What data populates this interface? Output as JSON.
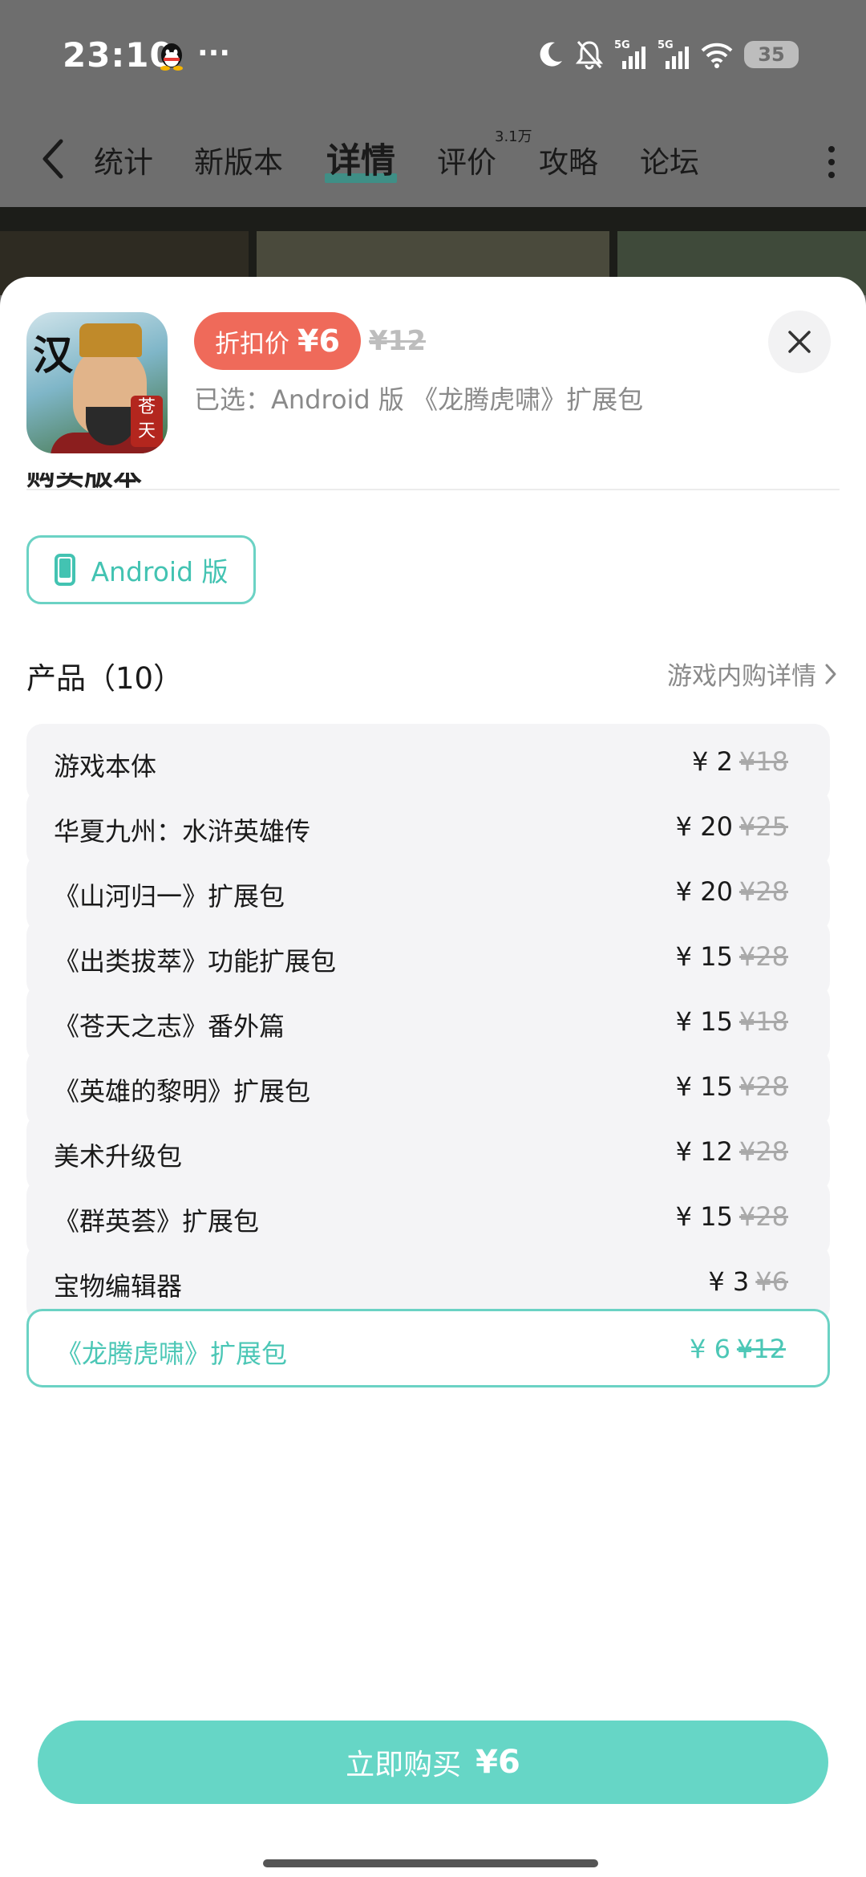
{
  "status_bar": {
    "time": "23:10",
    "more": "···",
    "battery": "35",
    "icons": [
      "qq-icon",
      "moon-icon",
      "bell-muted-icon",
      "signal-5g-icon",
      "signal-5g-icon",
      "wifi-icon",
      "battery-icon"
    ]
  },
  "nav": {
    "tabs": [
      "统计",
      "新版本",
      "详情",
      "评价",
      "攻略",
      "论坛"
    ],
    "active_tab": "详情",
    "review_count": "3.1万"
  },
  "sheet": {
    "discount_label": "折扣价",
    "discount_price": "¥6",
    "original_price": "¥12",
    "selected_text": "已选：Android 版 《龙腾虎啸》扩展包",
    "section_version_heading": "购买版本",
    "platform": "Android 版",
    "products_title": "产品（10）",
    "iap_link": "游戏内购详情",
    "products": [
      {
        "name": "游戏本体",
        "price": "¥ 2",
        "orig": "¥18"
      },
      {
        "name": "华夏九州：水浒英雄传",
        "price": "¥ 20",
        "orig": "¥25"
      },
      {
        "name": "《山河归一》扩展包",
        "price": "¥ 20",
        "orig": "¥28"
      },
      {
        "name": "《出类拔萃》功能扩展包",
        "price": "¥ 15",
        "orig": "¥28"
      },
      {
        "name": "《苍天之志》番外篇",
        "price": "¥ 15",
        "orig": "¥18"
      },
      {
        "name": "《英雄的黎明》扩展包",
        "price": "¥ 15",
        "orig": "¥28"
      },
      {
        "name": "美术升级包",
        "price": "¥ 12",
        "orig": "¥28"
      },
      {
        "name": "《群英荟》扩展包",
        "price": "¥ 15",
        "orig": "¥28"
      },
      {
        "name": "宝物编辑器",
        "price": "¥ 3",
        "orig": "¥6"
      },
      {
        "name": "《龙腾虎啸》扩展包",
        "price": "¥ 6",
        "orig": "¥12",
        "selected": true
      }
    ],
    "buy_label": "立即购买",
    "buy_price": "¥6"
  },
  "icon_logo": {
    "title_char": "汉",
    "seal_text": "苍天"
  },
  "colors": {
    "accent": "#66d6c6",
    "accent_text": "#4cc7b6",
    "discount": "#ef6a5a",
    "nav_underline": "#3f8f86"
  }
}
